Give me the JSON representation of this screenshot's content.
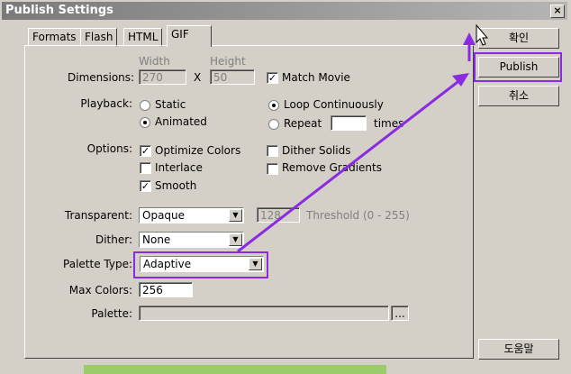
{
  "window": {
    "title": "Publish Settings",
    "close_glyph": "×"
  },
  "tabs": [
    {
      "label": "Formats"
    },
    {
      "label": "Flash"
    },
    {
      "label": "HTML"
    },
    {
      "label": "GIF"
    }
  ],
  "dimensions": {
    "label": "Dimensions:",
    "width_label": "Width",
    "width_value": "270",
    "height_label": "Height",
    "height_value": "50",
    "x_sep": "X",
    "match_movie_label": "Match Movie",
    "match_movie_checked": true
  },
  "playback": {
    "label": "Playback:",
    "static_label": "Static",
    "animated_label": "Animated",
    "selected": "Animated",
    "loop_label": "Loop Continuously",
    "repeat_label": "Repeat",
    "times_label": "times",
    "repeat_value": "",
    "loop_selected": "Loop Continuously"
  },
  "options": {
    "label": "Options:",
    "optimize_colors": "Optimize Colors",
    "interlace": "Interlace",
    "smooth": "Smooth",
    "dither_solids": "Dither Solids",
    "remove_gradients": "Remove Gradients",
    "checked": [
      "Optimize Colors",
      "Smooth"
    ]
  },
  "transparent": {
    "label": "Transparent:",
    "value": "Opaque",
    "threshold_value": "128",
    "threshold_label": "Threshold (0 - 255)"
  },
  "dither": {
    "label": "Dither:",
    "value": "None"
  },
  "palette_type": {
    "label": "Palette Type:",
    "value": "Adaptive"
  },
  "max_colors": {
    "label": "Max Colors:",
    "value": "256"
  },
  "palette": {
    "label": "Palette:",
    "value": "",
    "browse_label": "..."
  },
  "buttons": {
    "ok": "확인",
    "publish": "Publish",
    "cancel": "취소",
    "help": "도움말"
  },
  "annotation_color": "#8a2be2"
}
